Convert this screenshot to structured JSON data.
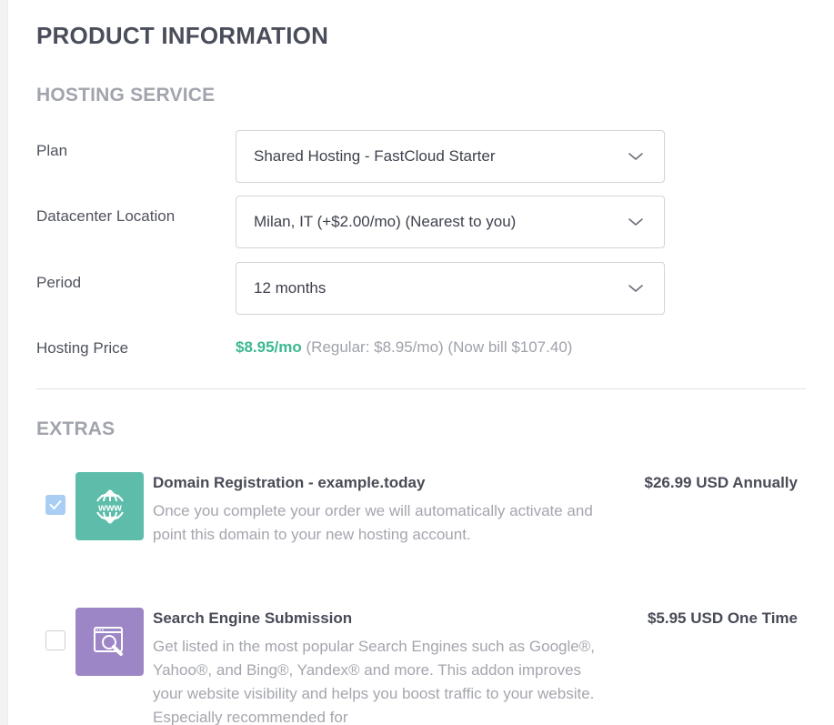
{
  "page_title": "PRODUCT INFORMATION",
  "hosting": {
    "section_title": "HOSTING SERVICE",
    "plan_label": "Plan",
    "plan_value": "Shared Hosting - FastCloud Starter",
    "location_label": "Datacenter Location",
    "location_value": "Milan, IT (+$2.00/mo) (Nearest to you)",
    "period_label": "Period",
    "period_value": "12 months",
    "price_label": "Hosting Price",
    "price_value": "$8.95/mo",
    "price_regular": "(Regular: $8.95/mo)",
    "price_bill": "(Now bill $107.40)"
  },
  "extras": {
    "section_title": "EXTRAS",
    "items": [
      {
        "title": "Domain Registration - example.today",
        "description": "Once you complete your order we will automatically activate and point this domain to your new hosting account.",
        "price": "$26.99 USD Annually",
        "checked": true,
        "icon": "globe-www-icon",
        "icon_text": "www",
        "tile_color": "#5dbdaa"
      },
      {
        "title": "Search Engine Submission",
        "description": "Get listed in the most popular Search Engines such as Google®, Yahoo®, and Bing®, Yandex® and more. This addon improves your website visibility and helps you boost traffic to your website. Especially recommended for",
        "price": "$5.95 USD One Time",
        "checked": false,
        "icon": "search-engine-icon",
        "tile_color": "#9d86c6"
      }
    ]
  },
  "colors": {
    "accent_green": "#3cb891",
    "checkbox_checked": "#a9cdf3"
  }
}
